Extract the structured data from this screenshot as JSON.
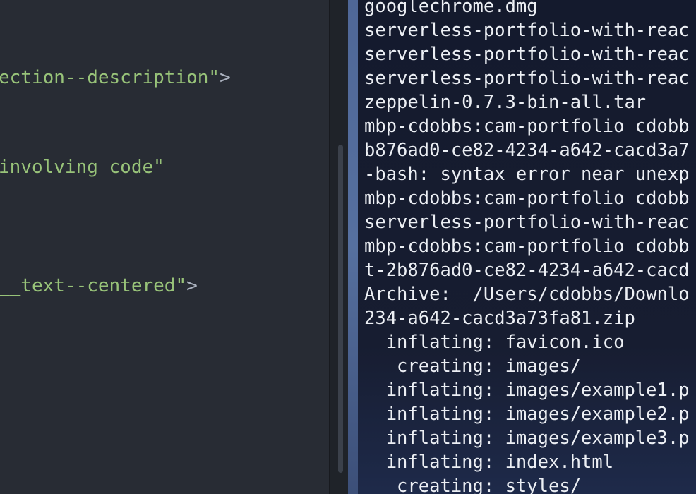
{
  "editor": {
    "lines": [
      {
        "string": "ection--description\"",
        "close": ">"
      },
      {
        "string": "involving code\"",
        "close": ""
      },
      {
        "string": "__text--centered\"",
        "close": ">"
      }
    ]
  },
  "terminal": {
    "lines": [
      "googlechrome.dmg",
      "serverless-portfolio-with-reac",
      "serverless-portfolio-with-reac",
      "serverless-portfolio-with-reac",
      "zeppelin-0.7.3-bin-all.tar",
      "mbp-cdobbs:cam-portfolio cdobb",
      "b876ad0-ce82-4234-a642-cacd3a7",
      "-bash: syntax error near unexp",
      "mbp-cdobbs:cam-portfolio cdobb",
      "serverless-portfolio-with-reac",
      "mbp-cdobbs:cam-portfolio cdobb",
      "t-2b876ad0-ce82-4234-a642-cacd",
      "Archive:  /Users/cdobbs/Downlo",
      "234-a642-cacd3a73fa81.zip",
      "  inflating: favicon.ico",
      "   creating: images/",
      "  inflating: images/example1.p",
      "  inflating: images/example2.p",
      "  inflating: images/example3.p",
      "  inflating: index.html",
      "   creating: styles/"
    ]
  }
}
